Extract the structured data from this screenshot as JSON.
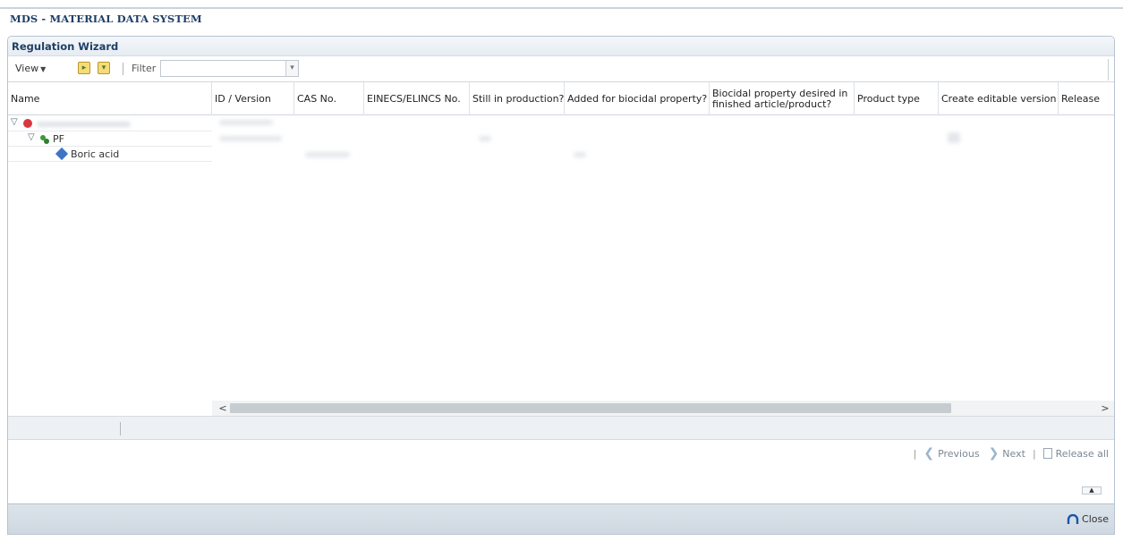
{
  "app": {
    "title": "MDS - MATERIAL DATA SYSTEM"
  },
  "wizard": {
    "title": "Regulation Wizard"
  },
  "toolbar": {
    "view_label": "View",
    "expand_icon": "expand-folder-icon",
    "collapse_icon": "collapse-folder-icon",
    "filter_label": "Filter",
    "filter_value": ""
  },
  "columns": [
    {
      "label": "Name"
    },
    {
      "label": "ID / Version"
    },
    {
      "label": "CAS No."
    },
    {
      "label": "EINECS/ELINCS No."
    },
    {
      "label": "Still in production?"
    },
    {
      "label": "Added for biocidal property?"
    },
    {
      "label": "Biocidal property desired in finished article/product?"
    },
    {
      "label": "Product type"
    },
    {
      "label": "Create editable version"
    },
    {
      "label": "Release"
    }
  ],
  "tree": [
    {
      "label": "",
      "icon": "stop-sign-icon",
      "color": "#d9363e",
      "expanded": true
    },
    {
      "label": "PF",
      "icon": "semi-component-icon",
      "color": "#3a9a3a",
      "expanded": true
    },
    {
      "label": "Boric acid",
      "icon": "substance-icon",
      "color": "#3d74c6"
    }
  ],
  "navigation": {
    "previous_label": "Previous",
    "next_label": "Next",
    "release_all_label": "Release all"
  },
  "footer": {
    "close_label": "Close"
  },
  "colors": {
    "title": "#1f3f66",
    "accent": "#1a56a8"
  }
}
